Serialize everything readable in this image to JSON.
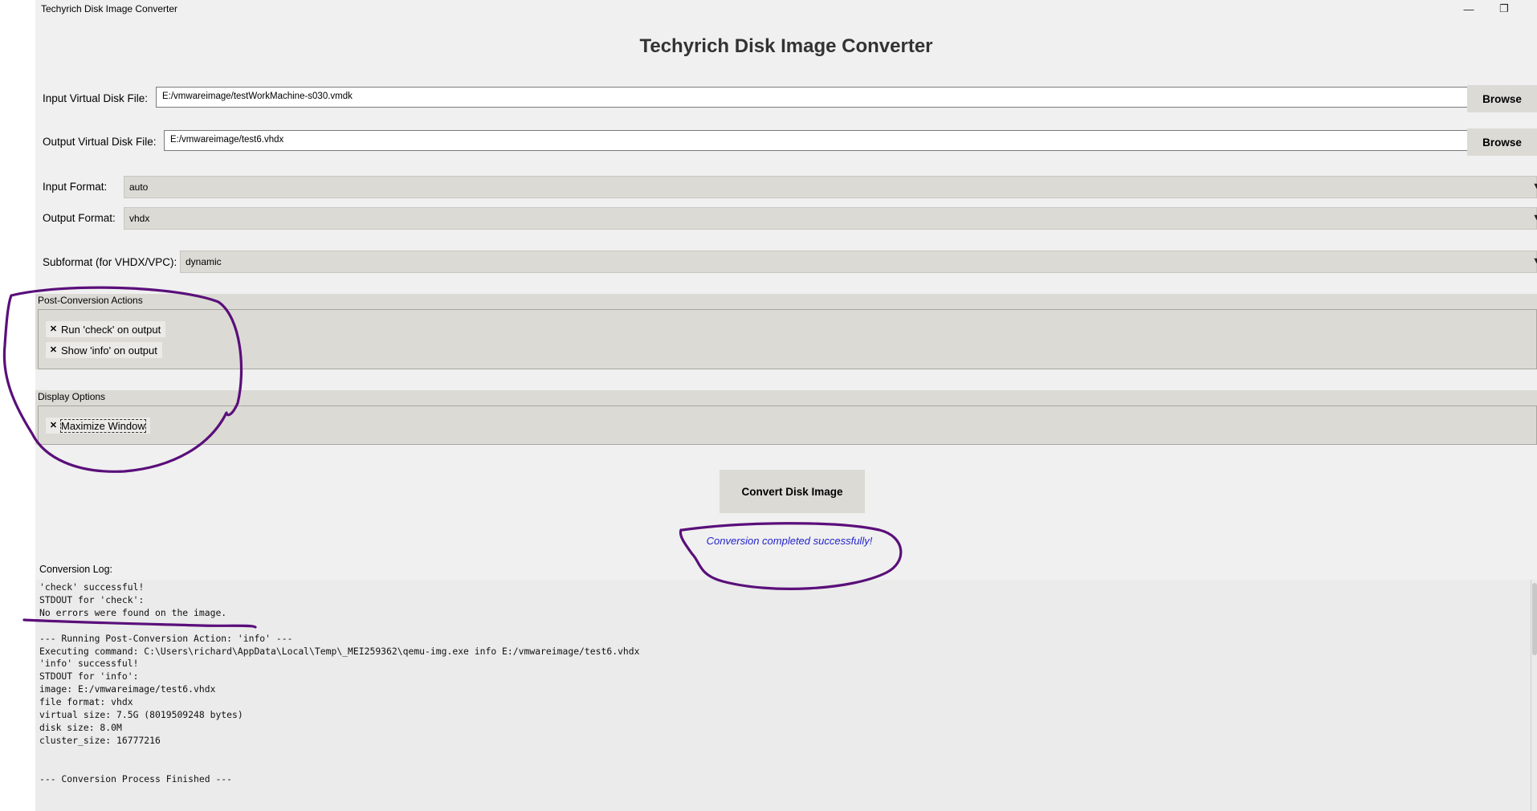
{
  "window": {
    "title": "Techyrich Disk Image Converter",
    "minimize_icon": "minimize-icon",
    "restore_icon": "restore-icon",
    "minimize_glyph": "—",
    "restore_glyph": "❐"
  },
  "app": {
    "heading": "Techyrich Disk Image Converter"
  },
  "input_file": {
    "label": "Input Virtual Disk File:",
    "value": "E:/vmwareimage/testWorkMachine-s030.vmdk",
    "browse_label": "Browse"
  },
  "output_file": {
    "label": "Output Virtual Disk File:",
    "value": "E:/vmwareimage/test6.vhdx",
    "browse_label": "Browse"
  },
  "input_format": {
    "label": "Input Format:",
    "selected": "auto"
  },
  "output_format": {
    "label": "Output Format:",
    "selected": "vhdx"
  },
  "subformat": {
    "label": "Subformat (for VHDX/VPC):",
    "selected": "dynamic"
  },
  "dropdown_icon": "chevron-down-icon",
  "dropdown_glyph": "▼",
  "post_actions": {
    "title": "Post-Conversion Actions",
    "items": [
      {
        "label": "Run 'check' on output",
        "checked": true
      },
      {
        "label": "Show 'info' on output",
        "checked": true
      }
    ]
  },
  "display_options": {
    "title": "Display Options",
    "items": [
      {
        "label": "Maximize Window",
        "checked": true
      }
    ]
  },
  "check_glyph": "✕",
  "convert_button": "Convert Disk Image",
  "status_message": "Conversion completed successfully!",
  "log": {
    "label": "Conversion Log:",
    "text": "'check' successful!\nSTDOUT for 'check':\nNo errors were found on the image.\n\n--- Running Post-Conversion Action: 'info' ---\nExecuting command: C:\\Users\\richard\\AppData\\Local\\Temp\\_MEI259362\\qemu-img.exe info E:/vmwareimage/test6.vhdx\n'info' successful!\nSTDOUT for 'info':\nimage: E:/vmwareimage/test6.vhdx\nfile format: vhdx\nvirtual size: 7.5G (8019509248 bytes)\ndisk size: 8.0M\ncluster_size: 16777216\n\n\n--- Conversion Process Finished ---"
  },
  "annotation_color": "#5a0f7a"
}
